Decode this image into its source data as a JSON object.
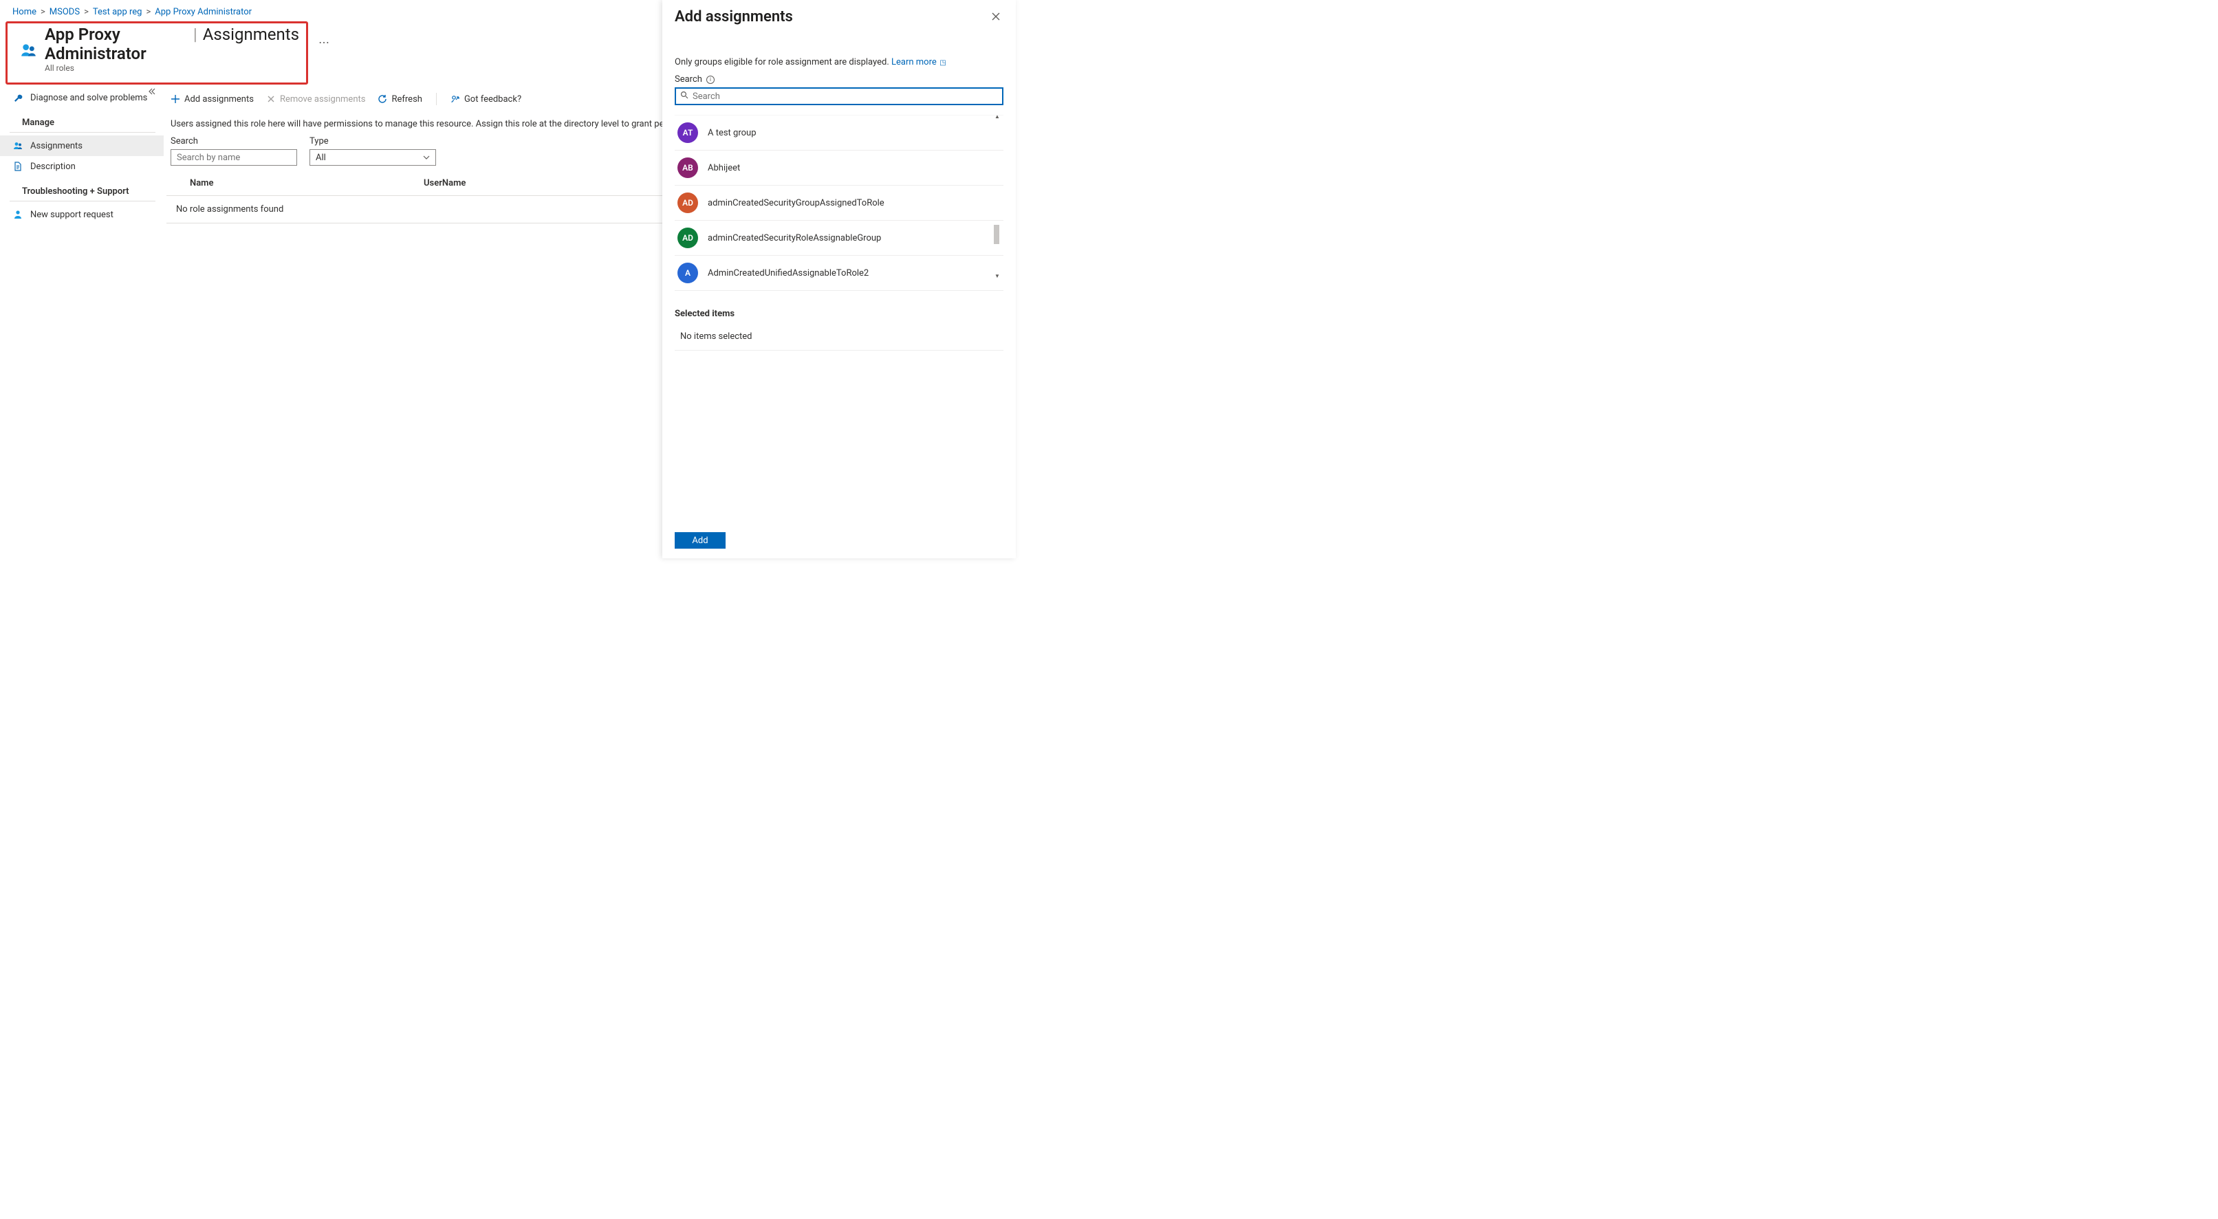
{
  "breadcrumb": {
    "items": [
      "Home",
      "MSODS",
      "Test app reg",
      "App Proxy Administrator"
    ]
  },
  "header": {
    "title_main": "App Proxy Administrator",
    "title_sub": "Assignments",
    "subtitle": "All roles",
    "more": "⋯"
  },
  "sidebar": {
    "diagnose": "Diagnose and solve problems",
    "manage_heading": "Manage",
    "assignments": "Assignments",
    "description": "Description",
    "support_heading": "Troubleshooting + Support",
    "new_support": "New support request"
  },
  "toolbar": {
    "add": "Add assignments",
    "remove": "Remove assignments",
    "refresh": "Refresh",
    "feedback": "Got feedback?"
  },
  "main": {
    "info": "Users assigned this role here will have permissions to manage this resource. Assign this role at the directory level to grant permissions",
    "search_label": "Search",
    "search_placeholder": "Search by name",
    "type_label": "Type",
    "type_value": "All",
    "col_name": "Name",
    "col_username": "UserName",
    "empty": "No role assignments found"
  },
  "blade": {
    "title": "Add assignments",
    "note_text": "Only groups eligible for role assignment are displayed.",
    "learn_more": "Learn more",
    "search_label": "Search",
    "search_placeholder": "Search",
    "groups": [
      {
        "initials": "AT",
        "color": "#6c2cbf",
        "name": "A test group"
      },
      {
        "initials": "AB",
        "color": "#8a226f",
        "name": "Abhijeet"
      },
      {
        "initials": "AD",
        "color": "#d1562d",
        "name": "adminCreatedSecurityGroupAssignedToRole"
      },
      {
        "initials": "AD",
        "color": "#0d7e3a",
        "name": "adminCreatedSecurityRoleAssignableGroup"
      },
      {
        "initials": "A",
        "color": "#2767d4",
        "name": "AdminCreatedUnifiedAssignableToRole2"
      }
    ],
    "selected_header": "Selected items",
    "selected_empty": "No items selected",
    "add_button": "Add"
  }
}
